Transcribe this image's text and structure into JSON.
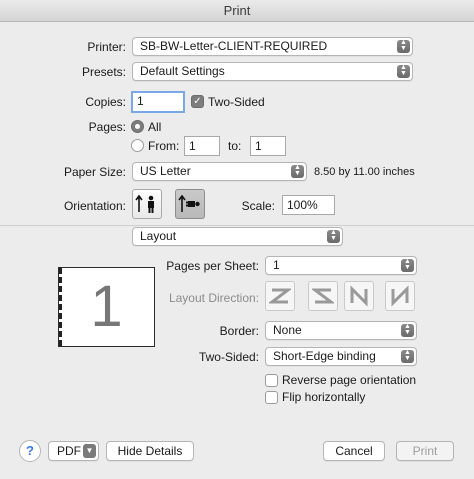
{
  "window": {
    "title": "Print"
  },
  "printer": {
    "label": "Printer:",
    "value": "SB-BW-Letter-CLIENT-REQUIRED"
  },
  "presets": {
    "label": "Presets:",
    "value": "Default Settings"
  },
  "copies": {
    "label": "Copies:",
    "value": "1",
    "two_sided_label": "Two-Sided",
    "two_sided_checked": true
  },
  "pages": {
    "label": "Pages:",
    "all_label": "All",
    "from_label": "From:",
    "from_value": "1",
    "to_label": "to:",
    "to_value": "1"
  },
  "paper_size": {
    "label": "Paper Size:",
    "value": "US Letter",
    "dimensions": "8.50 by 11.00 inches"
  },
  "orientation": {
    "label": "Orientation:",
    "options": [
      "portrait-icon",
      "landscape-icon"
    ],
    "selected": "landscape-icon"
  },
  "scale": {
    "label": "Scale:",
    "value": "100%"
  },
  "section": {
    "value": "Layout"
  },
  "preview": {
    "page_number": "1"
  },
  "layout": {
    "pages_per_sheet_label": "Pages per Sheet:",
    "pages_per_sheet_value": "1",
    "direction_label": "Layout Direction:",
    "direction_icons": [
      "z-direction-icon",
      "reverse-z-direction-icon",
      "n-direction-icon",
      "reverse-n-direction-icon"
    ],
    "border_label": "Border:",
    "border_value": "None",
    "two_sided_label": "Two-Sided:",
    "two_sided_value": "Short-Edge binding",
    "reverse_label": "Reverse page orientation",
    "flip_label": "Flip horizontally"
  },
  "footer": {
    "help_label": "?",
    "pdf_label": "PDF",
    "details_label": "Hide Details",
    "cancel_label": "Cancel",
    "print_label": "Print"
  }
}
